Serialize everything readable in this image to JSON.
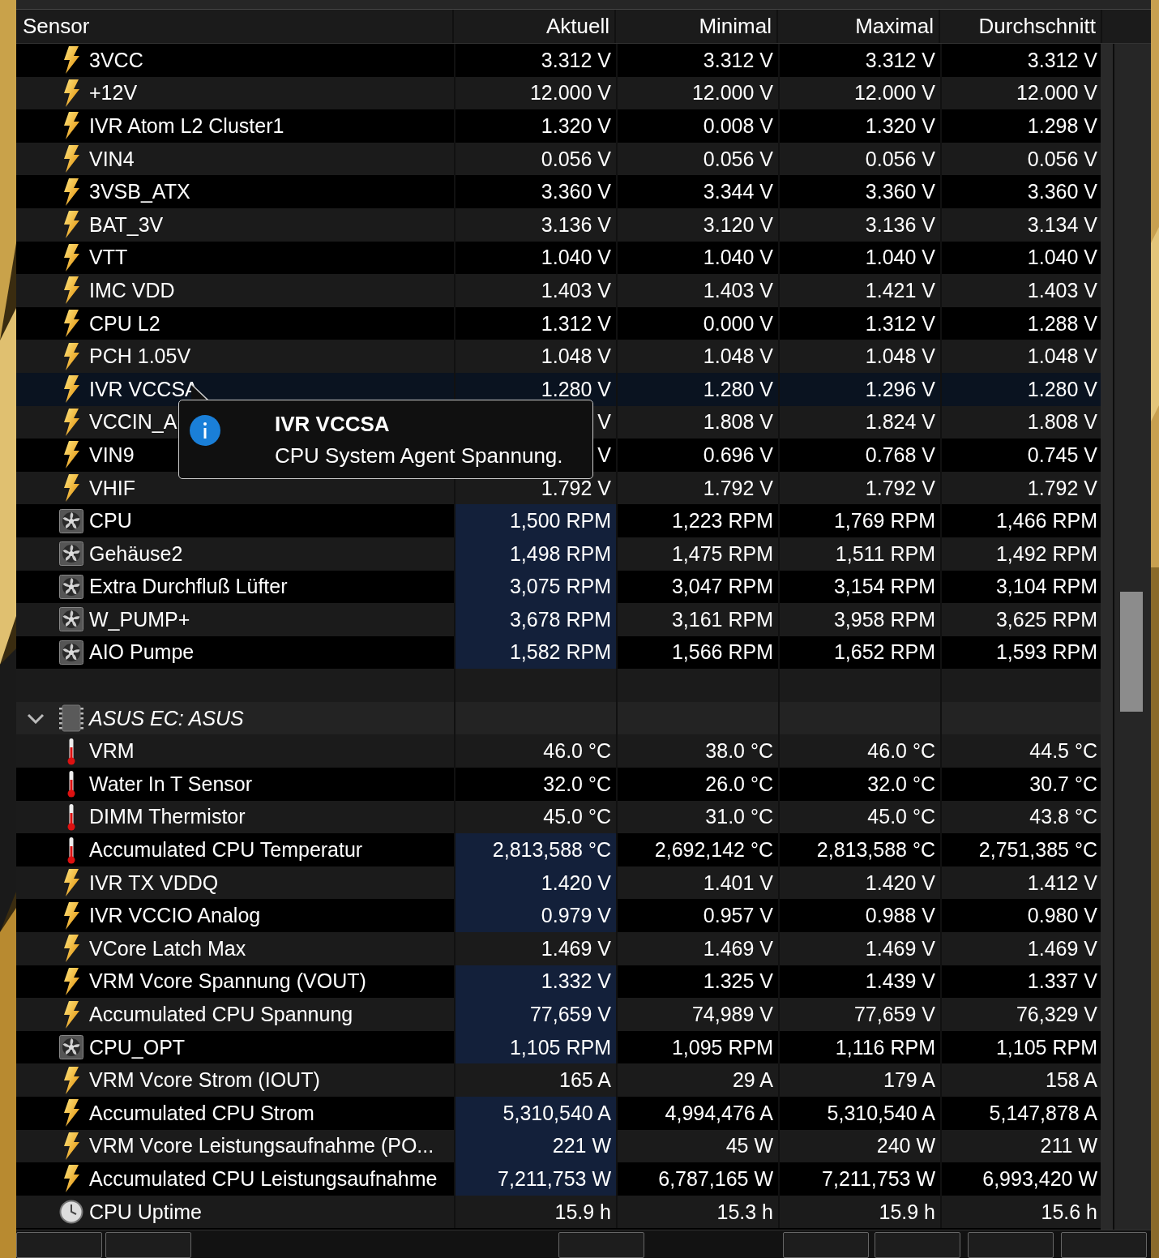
{
  "columns": [
    "Sensor",
    "Aktuell",
    "Minimal",
    "Maximal",
    "Durchschnitt"
  ],
  "rows": [
    {
      "kind": "voltage",
      "name": "3VCC",
      "values": [
        "3.312 V",
        "3.312 V",
        "3.312 V",
        "3.312 V"
      ],
      "highlighted": false,
      "hovered": false
    },
    {
      "kind": "voltage",
      "name": "+12V",
      "values": [
        "12.000 V",
        "12.000 V",
        "12.000 V",
        "12.000 V"
      ],
      "highlighted": false,
      "hovered": false
    },
    {
      "kind": "voltage",
      "name": "IVR Atom L2 Cluster1",
      "values": [
        "1.320 V",
        "0.008 V",
        "1.320 V",
        "1.298 V"
      ],
      "highlighted": false,
      "hovered": false
    },
    {
      "kind": "voltage",
      "name": "VIN4",
      "values": [
        "0.056 V",
        "0.056 V",
        "0.056 V",
        "0.056 V"
      ],
      "highlighted": false,
      "hovered": false
    },
    {
      "kind": "voltage",
      "name": "3VSB_ATX",
      "values": [
        "3.360 V",
        "3.344 V",
        "3.360 V",
        "3.360 V"
      ],
      "highlighted": false,
      "hovered": false
    },
    {
      "kind": "voltage",
      "name": "BAT_3V",
      "values": [
        "3.136 V",
        "3.120 V",
        "3.136 V",
        "3.134 V"
      ],
      "highlighted": false,
      "hovered": false
    },
    {
      "kind": "voltage",
      "name": "VTT",
      "values": [
        "1.040 V",
        "1.040 V",
        "1.040 V",
        "1.040 V"
      ],
      "highlighted": false,
      "hovered": false
    },
    {
      "kind": "voltage",
      "name": "IMC VDD",
      "values": [
        "1.403 V",
        "1.403 V",
        "1.421 V",
        "1.403 V"
      ],
      "highlighted": false,
      "hovered": false
    },
    {
      "kind": "voltage",
      "name": "CPU L2",
      "values": [
        "1.312 V",
        "0.000 V",
        "1.312 V",
        "1.288 V"
      ],
      "highlighted": false,
      "hovered": false
    },
    {
      "kind": "voltage",
      "name": "PCH 1.05V",
      "values": [
        "1.048 V",
        "1.048 V",
        "1.048 V",
        "1.048 V"
      ],
      "highlighted": false,
      "hovered": false
    },
    {
      "kind": "voltage",
      "name": "IVR VCCSA",
      "values": [
        "1.280 V",
        "1.280 V",
        "1.296 V",
        "1.280 V"
      ],
      "highlighted": false,
      "hovered": true
    },
    {
      "kind": "voltage",
      "name": "VCCIN_A",
      "values": [
        "V",
        "1.808 V",
        "1.824 V",
        "1.808 V"
      ],
      "highlighted": false,
      "hovered": false
    },
    {
      "kind": "voltage",
      "name": "VIN9",
      "values": [
        "V",
        "0.696 V",
        "0.768 V",
        "0.745 V"
      ],
      "highlighted": false,
      "hovered": false
    },
    {
      "kind": "voltage",
      "name": "VHIF",
      "values": [
        "1.792 V",
        "1.792 V",
        "1.792 V",
        "1.792 V"
      ],
      "highlighted": false,
      "hovered": false
    },
    {
      "kind": "fan",
      "name": "CPU",
      "values": [
        "1,500 RPM",
        "1,223 RPM",
        "1,769 RPM",
        "1,466 RPM"
      ],
      "highlighted": true,
      "hovered": false
    },
    {
      "kind": "fan",
      "name": "Gehäuse2",
      "values": [
        "1,498 RPM",
        "1,475 RPM",
        "1,511 RPM",
        "1,492 RPM"
      ],
      "highlighted": true,
      "hovered": false
    },
    {
      "kind": "fan",
      "name": "Extra Durchfluß Lüfter",
      "values": [
        "3,075 RPM",
        "3,047 RPM",
        "3,154 RPM",
        "3,104 RPM"
      ],
      "highlighted": true,
      "hovered": false
    },
    {
      "kind": "fan",
      "name": "W_PUMP+",
      "values": [
        "3,678 RPM",
        "3,161 RPM",
        "3,958 RPM",
        "3,625 RPM"
      ],
      "highlighted": true,
      "hovered": false
    },
    {
      "kind": "fan",
      "name": "AIO Pumpe",
      "values": [
        "1,582 RPM",
        "1,566 RPM",
        "1,652 RPM",
        "1,593 RPM"
      ],
      "highlighted": true,
      "hovered": false
    },
    {
      "kind": "spacer"
    },
    {
      "kind": "group",
      "name": "ASUS EC: ASUS",
      "expanded": true
    },
    {
      "kind": "temperature",
      "name": "VRM",
      "values": [
        "46.0 °C",
        "38.0 °C",
        "46.0 °C",
        "44.5 °C"
      ],
      "highlighted": false,
      "hovered": false
    },
    {
      "kind": "temperature",
      "name": "Water In T Sensor",
      "values": [
        "32.0 °C",
        "26.0 °C",
        "32.0 °C",
        "30.7 °C"
      ],
      "highlighted": false,
      "hovered": false
    },
    {
      "kind": "temperature",
      "name": "DIMM Thermistor",
      "values": [
        "45.0 °C",
        "31.0 °C",
        "45.0 °C",
        "43.8 °C"
      ],
      "highlighted": false,
      "hovered": false
    },
    {
      "kind": "temperature",
      "name": "Accumulated CPU Temperatur",
      "values": [
        "2,813,588 °C",
        "2,692,142 °C",
        "2,813,588 °C",
        "2,751,385 °C"
      ],
      "highlighted": true,
      "hovered": false
    },
    {
      "kind": "voltage",
      "name": "IVR TX VDDQ",
      "values": [
        "1.420 V",
        "1.401 V",
        "1.420 V",
        "1.412 V"
      ],
      "highlighted": true,
      "hovered": false
    },
    {
      "kind": "voltage",
      "name": "IVR VCCIO Analog",
      "values": [
        "0.979 V",
        "0.957 V",
        "0.988 V",
        "0.980 V"
      ],
      "highlighted": true,
      "hovered": false
    },
    {
      "kind": "voltage",
      "name": "VCore Latch Max",
      "values": [
        "1.469 V",
        "1.469 V",
        "1.469 V",
        "1.469 V"
      ],
      "highlighted": false,
      "hovered": false
    },
    {
      "kind": "voltage",
      "name": "VRM Vcore Spannung (VOUT)",
      "values": [
        "1.332 V",
        "1.325 V",
        "1.439 V",
        "1.337 V"
      ],
      "highlighted": true,
      "hovered": false
    },
    {
      "kind": "voltage",
      "name": "Accumulated CPU Spannung",
      "values": [
        "77,659 V",
        "74,989 V",
        "77,659 V",
        "76,329 V"
      ],
      "highlighted": true,
      "hovered": false
    },
    {
      "kind": "fan",
      "name": "CPU_OPT",
      "values": [
        "1,105 RPM",
        "1,095 RPM",
        "1,116 RPM",
        "1,105 RPM"
      ],
      "highlighted": true,
      "hovered": false
    },
    {
      "kind": "voltage",
      "name": "VRM Vcore Strom (IOUT)",
      "values": [
        "165 A",
        "29 A",
        "179 A",
        "158 A"
      ],
      "highlighted": false,
      "hovered": false
    },
    {
      "kind": "voltage",
      "name": "Accumulated CPU Strom",
      "values": [
        "5,310,540 A",
        "4,994,476 A",
        "5,310,540 A",
        "5,147,878 A"
      ],
      "highlighted": true,
      "hovered": false
    },
    {
      "kind": "voltage",
      "name": "VRM Vcore Leistungsaufnahme (PO...",
      "values": [
        "221 W",
        "45 W",
        "240 W",
        "211 W"
      ],
      "highlighted": true,
      "hovered": false
    },
    {
      "kind": "voltage",
      "name": "Accumulated CPU Leistungsaufnahme",
      "values": [
        "7,211,753 W",
        "6,787,165 W",
        "7,211,753 W",
        "6,993,420 W"
      ],
      "highlighted": true,
      "hovered": false
    },
    {
      "kind": "clock",
      "name": "CPU Uptime",
      "values": [
        "15.9 h",
        "15.3 h",
        "15.9 h",
        "15.6 h"
      ],
      "highlighted": false,
      "hovered": false
    }
  ],
  "tooltip": {
    "title": "IVR VCCSA",
    "text": "CPU System Agent Spannung."
  }
}
